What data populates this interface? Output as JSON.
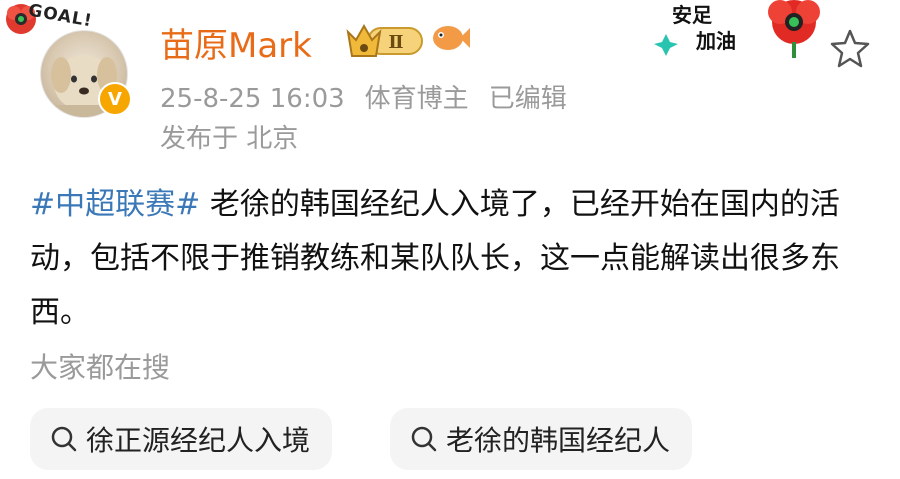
{
  "user": {
    "name": "苗原Mark",
    "vip_level": "Ⅱ",
    "verified_mark": "V",
    "avatar_sticker": "GOAL!"
  },
  "post_meta": {
    "time": "25-8-25 16:03",
    "tag": "体育博主",
    "edited": "已编辑",
    "location": "发布于 北京"
  },
  "sticker": {
    "line1": "安足",
    "line2": "加油"
  },
  "post": {
    "hashtag": "#中超联赛#",
    "body": " 老徐的韩国经纪人入境了，已经开始在国内的活动，包括不限于推销教练和某队队长，这一点能解读出很多东西。"
  },
  "suggestions": {
    "title": "大家都在搜",
    "items": [
      {
        "label": "徐正源经纪人入境"
      },
      {
        "label": "老徐的韩国经纪人"
      }
    ]
  },
  "colors": {
    "username": "#e86c18",
    "hashtag": "#3b78b8",
    "meta": "#9a9a9a",
    "chip_bg": "#f4f4f4"
  },
  "icons": [
    "flower-icon",
    "vip-crown-icon",
    "fish-icon",
    "star-icon",
    "search-icon"
  ]
}
